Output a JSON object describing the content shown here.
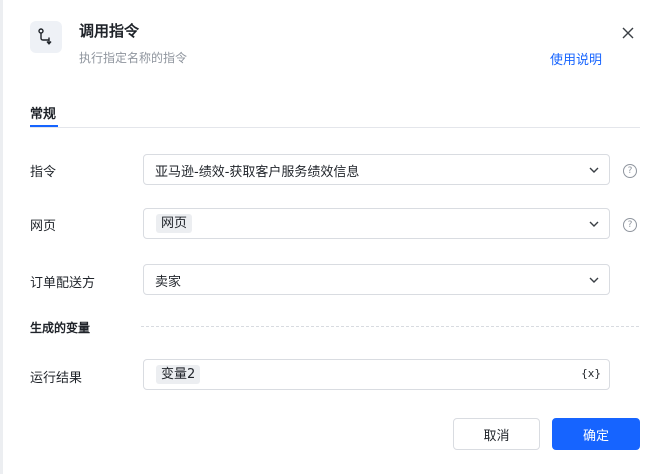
{
  "header": {
    "icon": "command-flow-icon",
    "title": "调用指令",
    "subtitle": "执行指定名称的指令",
    "help_link": "使用说明",
    "close_icon": "close-icon"
  },
  "tabs": [
    {
      "label": "常规",
      "active": true
    }
  ],
  "fields": {
    "command": {
      "label": "指令",
      "value": "亚马逊-绩效-获取客户服务绩效信息"
    },
    "webpage": {
      "label": "网页",
      "value": "网页"
    },
    "shipping": {
      "label": "订单配送方",
      "value": "卖家"
    }
  },
  "output_section": {
    "title": "生成的变量",
    "result": {
      "label": "运行结果",
      "value": "变量2",
      "var_icon": "{x}"
    }
  },
  "help_icon_glyph": "?",
  "footer": {
    "cancel_label": "取消",
    "ok_label": "确定"
  },
  "colors": {
    "accent": "#1664ff",
    "border": "#d9dce1",
    "muted_text": "#8f959e"
  }
}
